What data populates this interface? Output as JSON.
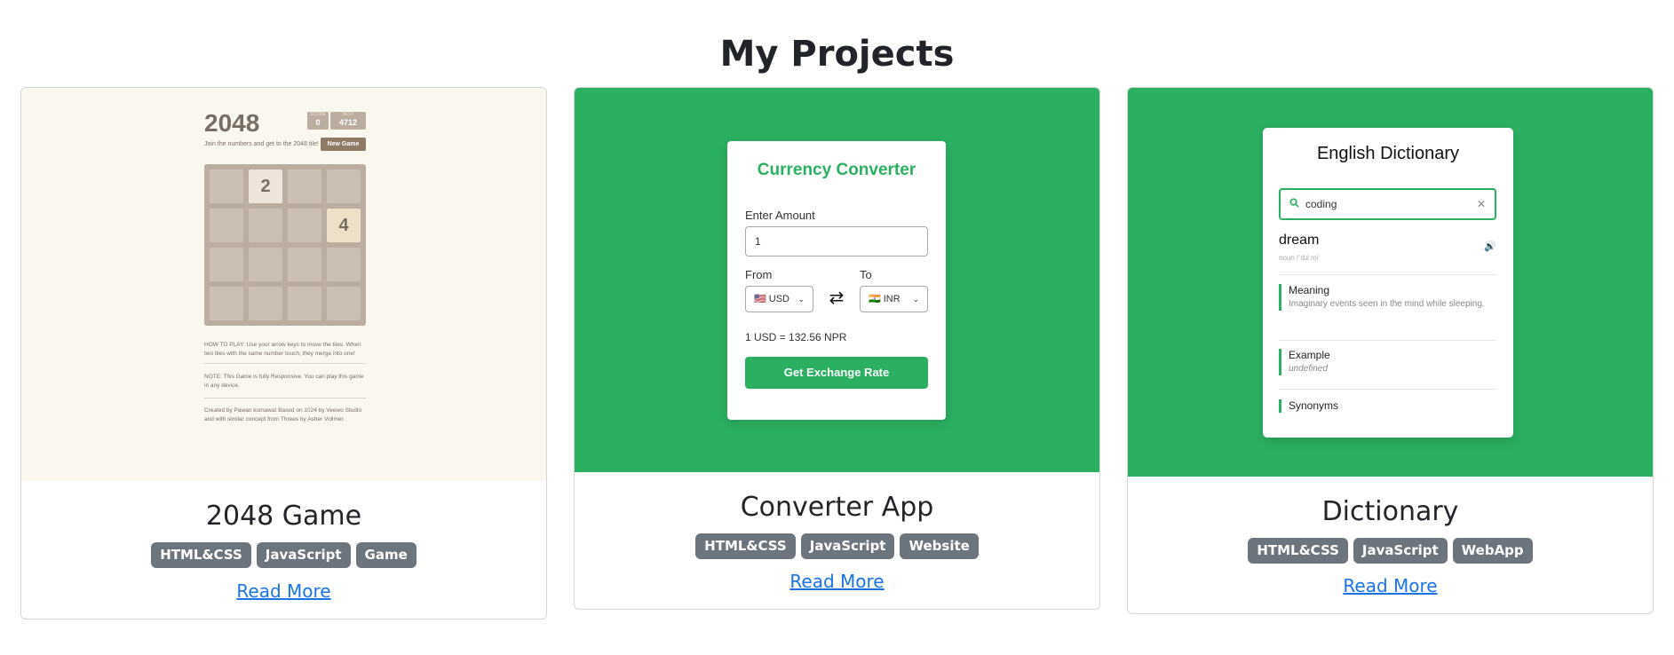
{
  "page": {
    "title": "My Projects"
  },
  "projects": [
    {
      "title": "2048 Game",
      "tags": [
        "HTML&CSS",
        "JavaScript",
        "Game"
      ],
      "link_label": "Read More",
      "preview": {
        "game_title": "2048",
        "score_label": "SCORE",
        "score_value": "0",
        "best_label": "BEST",
        "best_value": "4712",
        "intro": "Join the numbers and get to the 2048 tile!",
        "new_game_label": "New Game",
        "tiles": [
          {
            "row": 0,
            "col": 1,
            "value": "2"
          },
          {
            "row": 1,
            "col": 3,
            "value": "4"
          }
        ],
        "how_to_play": "HOW TO PLAY: Use your arrow keys to move the tiles. When two tiles with the same number touch, they merge into one!",
        "note": "NOTE: This Game is fully Responsive. You can play this game in any device.",
        "credits": "Created by Pawan kumawat Based on 1024 by Veewo Studio and with similar concept from Threes by Asher Vollmer."
      }
    },
    {
      "title": "Converter App",
      "tags": [
        "HTML&CSS",
        "JavaScript",
        "Website"
      ],
      "link_label": "Read More",
      "preview": {
        "heading": "Currency Converter",
        "amount_label": "Enter Amount",
        "amount_value": "1",
        "from_label": "From",
        "from_value": "🇺🇸 USD",
        "to_label": "To",
        "to_value": "🇮🇳 INR",
        "swap_icon": "⇄",
        "rate_text": "1 USD = 132.56 NPR",
        "button_label": "Get Exchange Rate"
      }
    },
    {
      "title": "Dictionary",
      "tags": [
        "HTML&CSS",
        "JavaScript",
        "WebApp"
      ],
      "link_label": "Read More",
      "preview": {
        "heading": "English Dictionary",
        "search_value": "coding",
        "word": "dream",
        "phonetic": "noun /ˈdɹiːm/",
        "meaning_label": "Meaning",
        "meaning_text": "Imaginary events seen in the mind while sleeping.",
        "example_label": "Example",
        "example_text": "undefined",
        "synonyms_label": "Synonyms"
      }
    }
  ],
  "colors": {
    "accent_green": "#2bb062",
    "tag_gray": "#6c757d",
    "link_blue": "#1a73e8",
    "beige": "#faf7ef"
  },
  "icons": {
    "search": "search-icon",
    "clear": "close-icon",
    "speaker": "speaker-icon",
    "swap": "swap-icon",
    "chevron": "chevron-down-icon"
  }
}
